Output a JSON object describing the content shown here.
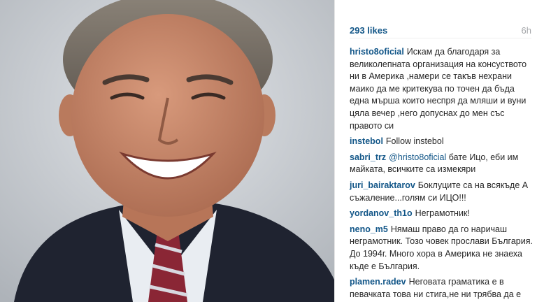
{
  "post": {
    "likes": "293 likes",
    "time": "6h"
  },
  "comments": [
    {
      "user": "hristo8oficial",
      "mention": "",
      "text": "Искам да благодаря за великолепната организация на консуството ни в Америка ,намери се такъв нехрани маико да ме критекува по точен да бъда една мърша които неспря да мляши и вуни цяла вечер ,него допуснах до мен със правото си"
    },
    {
      "user": "instebol",
      "mention": "",
      "text": "Follow instebol"
    },
    {
      "user": "sabri_trz",
      "mention": "@hristo8oficial",
      "text": "бате Ицо, еби им майката, всичките са измекяри"
    },
    {
      "user": "juri_bairaktarov",
      "mention": "",
      "text": "Боклуците са на всякъде А съжаление...голям си ИЦО!!!"
    },
    {
      "user": "yordanov_th1o",
      "mention": "",
      "text": "Неграмотник!"
    },
    {
      "user": "neno_m5",
      "mention": "",
      "text": "Нямаш право да го наричаш неграмотник. Тозо човек прослави България. До 1994г. Много хора в Америка не знаеха къде е България."
    },
    {
      "user": "plamen.radev",
      "mention": "",
      "text": "Неговата граматика е в певачката това ни стига,не ни трябва да е професор нали така Бате Ицо"
    }
  ],
  "colors": {
    "link": "#125688",
    "text": "#262626",
    "muted": "#a5a7aa"
  }
}
